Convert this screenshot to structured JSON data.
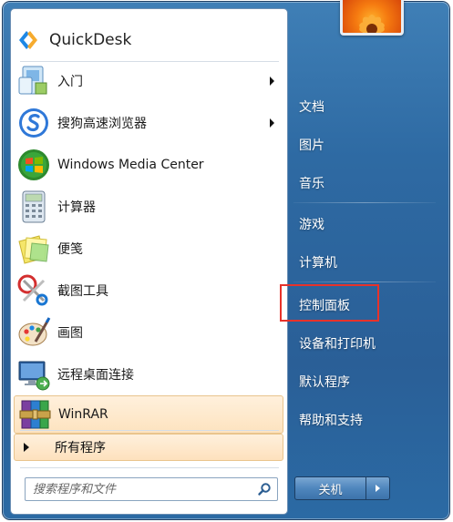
{
  "pinned_top": {
    "label": "QuickDesk",
    "icon": "quickdesk-logo-icon"
  },
  "programs": [
    {
      "label": "入门",
      "icon": "getting-started-icon",
      "has_submenu": true
    },
    {
      "label": "搜狗高速浏览器",
      "icon": "sogou-browser-icon",
      "has_submenu": true
    },
    {
      "label": "Windows Media Center",
      "icon": "windows-media-center-icon",
      "has_submenu": false
    },
    {
      "label": "计算器",
      "icon": "calculator-icon",
      "has_submenu": false
    },
    {
      "label": "便笺",
      "icon": "sticky-notes-icon",
      "has_submenu": false
    },
    {
      "label": "截图工具",
      "icon": "snipping-tool-icon",
      "has_submenu": false
    },
    {
      "label": "画图",
      "icon": "paint-icon",
      "has_submenu": false
    },
    {
      "label": "远程桌面连接",
      "icon": "remote-desktop-icon",
      "has_submenu": false
    },
    {
      "label": "WinRAR",
      "icon": "winrar-icon",
      "has_submenu": false,
      "highlighted": true
    }
  ],
  "all_programs": {
    "label": "所有程序"
  },
  "search": {
    "placeholder": "搜索程序和文件",
    "icon": "search-icon"
  },
  "right_links": [
    {
      "label": "文档"
    },
    {
      "label": "图片"
    },
    {
      "label": "音乐"
    },
    {
      "label": "游戏"
    },
    {
      "label": "计算机"
    },
    {
      "label": "控制面板",
      "highlighted_box": true
    },
    {
      "label": "设备和打印机"
    },
    {
      "label": "默认程序"
    },
    {
      "label": "帮助和支持"
    }
  ],
  "shutdown": {
    "label": "关机"
  },
  "user_picture": {
    "icon": "user-picture-flower-icon"
  },
  "colors": {
    "frame_blue": "#2e6aa3",
    "pinned_highlight": "#fde3bf",
    "red_annotation": "#e8322a"
  }
}
